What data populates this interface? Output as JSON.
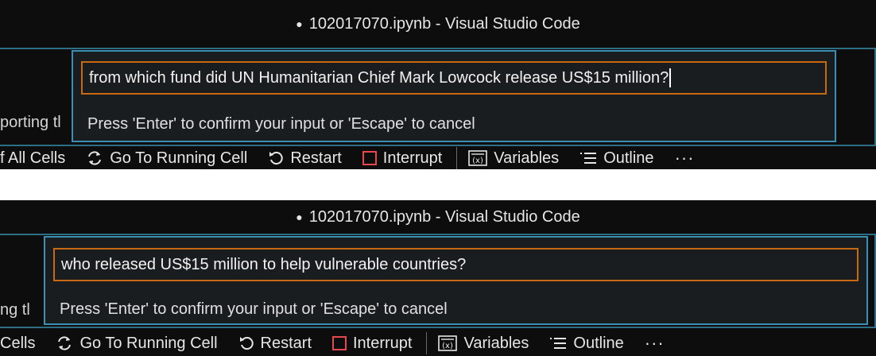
{
  "window_title": "102017070.ipynb - Visual Studio Code",
  "hint": "Press 'Enter' to confirm your input or 'Escape' to cancel",
  "panel1": {
    "input_value": "from which fund did UN Humanitarian Chief Mark Lowcock release US$15 million?",
    "behind_text": "porting tl",
    "toolbar_clipped": "f All Cells"
  },
  "panel2": {
    "input_value": "who released US$15 million to help vulnerable countries?",
    "behind_text": "ng tl",
    "toolbar_clipped": "Cells"
  },
  "toolbar": {
    "go_to_running_cell": "Go To Running Cell",
    "restart": "Restart",
    "interrupt": "Interrupt",
    "variables": "Variables",
    "outline": "Outline",
    "more": "···"
  },
  "colors": {
    "background": "#0d0d0d",
    "accent_border": "#3b8fb3",
    "input_border": "#c96a12",
    "interrupt_red": "#e5484d"
  }
}
